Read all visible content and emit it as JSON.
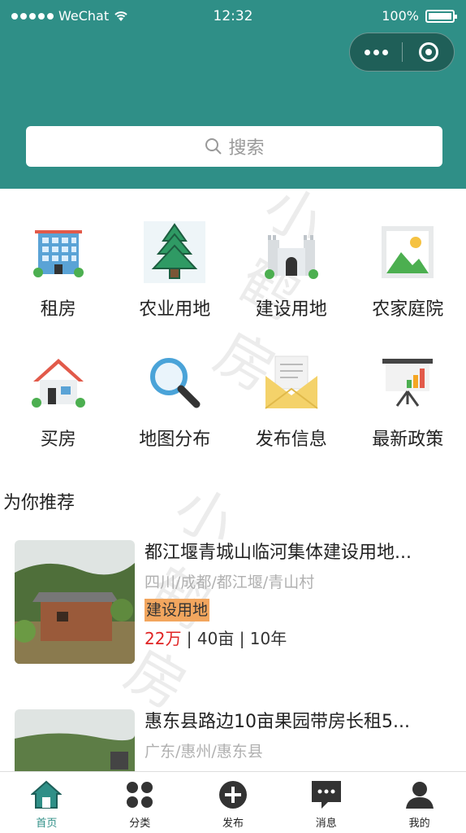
{
  "status_bar": {
    "carrier": "WeChat",
    "time": "12:32",
    "battery": "100%"
  },
  "search": {
    "placeholder": "搜索"
  },
  "categories": [
    {
      "label": "租房",
      "icon": "building-icon"
    },
    {
      "label": "农业用地",
      "icon": "pine-tree-icon"
    },
    {
      "label": "建设用地",
      "icon": "castle-icon"
    },
    {
      "label": "农家庭院",
      "icon": "landscape-picture-icon"
    },
    {
      "label": "买房",
      "icon": "house-icon"
    },
    {
      "label": "地图分布",
      "icon": "magnifier-icon"
    },
    {
      "label": "发布信息",
      "icon": "envelope-icon"
    },
    {
      "label": "最新政策",
      "icon": "presentation-board-icon"
    }
  ],
  "recommend": {
    "title": "为你推荐",
    "items": [
      {
        "title": "都江堰青城山临河集体建设用地...",
        "location": "四川/成都/都江堰/青山村",
        "tag": "建设用地",
        "price": "22万",
        "meta": " | 40亩 | 10年"
      },
      {
        "title": "惠东县路边10亩果园带房长租5...",
        "location": "广东/惠州/惠东县",
        "tag": "",
        "price": "",
        "meta": ""
      }
    ]
  },
  "tabbar": [
    {
      "label": "首页",
      "icon": "home-icon",
      "active": true
    },
    {
      "label": "分类",
      "icon": "grid-dots-icon",
      "active": false
    },
    {
      "label": "发布",
      "icon": "plus-circle-icon",
      "active": false
    },
    {
      "label": "消息",
      "icon": "chat-bubble-icon",
      "active": false
    },
    {
      "label": "我的",
      "icon": "user-icon",
      "active": false
    }
  ],
  "colors": {
    "brand": "#2f8f87",
    "price": "#e02424",
    "tag_bg": "#f2a65e"
  }
}
